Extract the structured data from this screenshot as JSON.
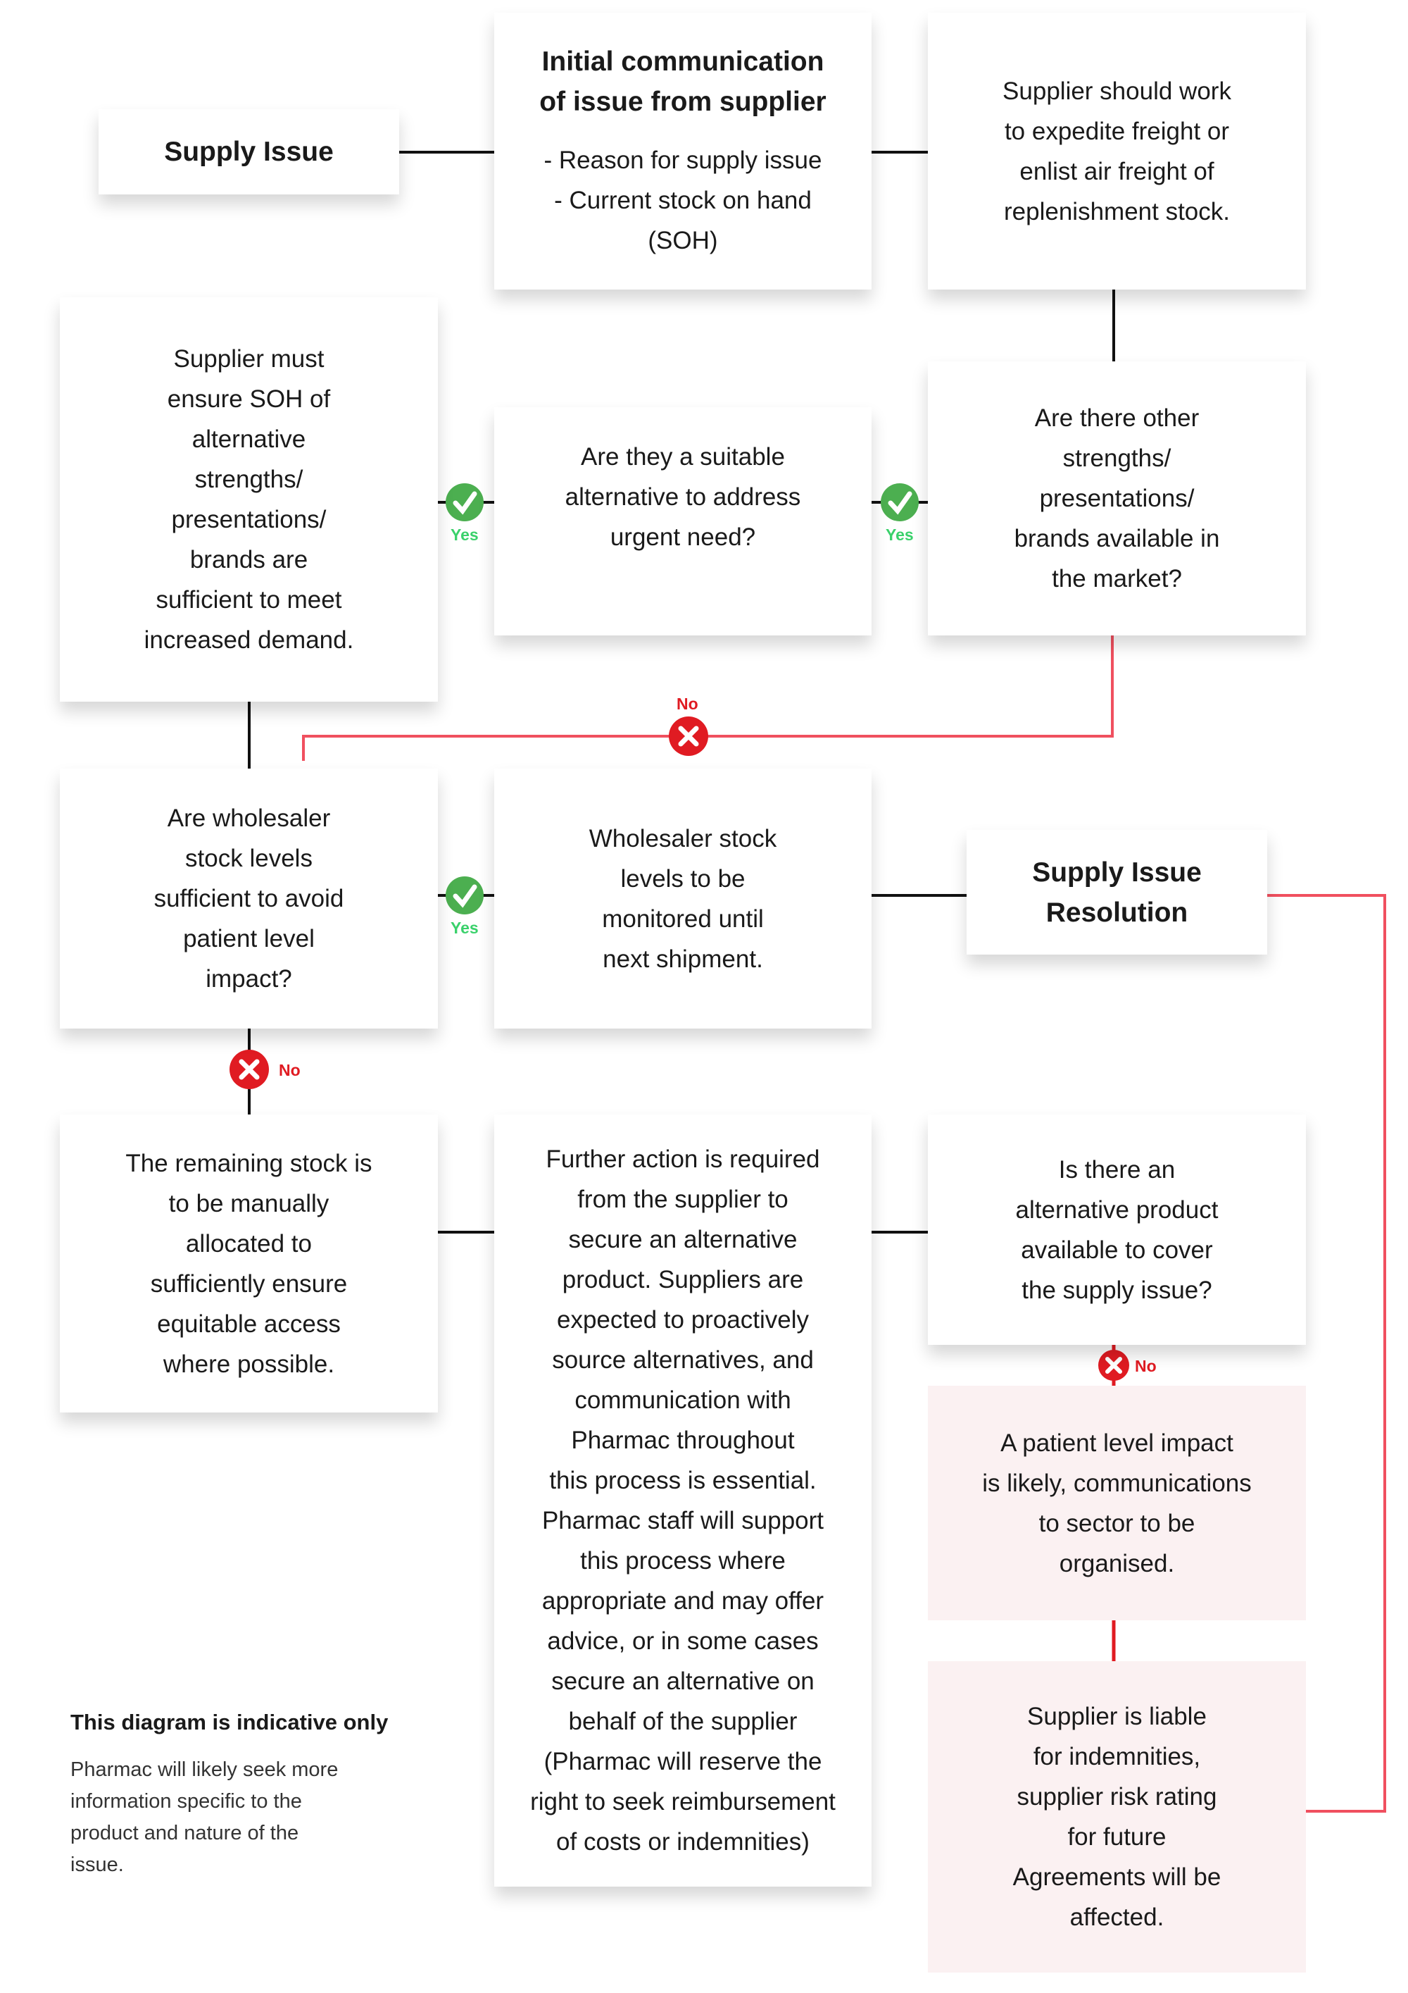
{
  "colors": {
    "yes": "#4caf50",
    "no": "#e01b22",
    "red_line": "#f0505f",
    "pink_box": "#fbf1f2"
  },
  "nodes": {
    "supply_issue": {
      "title": "Supply Issue"
    },
    "initial_comm": {
      "title": "Initial communication\nof issue from supplier",
      "body": "- Reason for supply issue\n- Current stock on hand\n(SOH)"
    },
    "expedite": {
      "body": "Supplier should work\nto expedite freight or\nenlist air freight of\nreplenishment stock."
    },
    "ensure_soh": {
      "body": "Supplier must\nensure SOH of\nalternative\nstrengths/\npresentations/\nbrands are\nsufficient to meet\nincreased demand."
    },
    "suitable": {
      "body": "Are they a suitable\nalternative to address\nurgent need?"
    },
    "other_strengths": {
      "body": "Are there other\nstrengths/\npresentations/\nbrands available in\nthe market?"
    },
    "wholesaler_levels": {
      "body": "Are wholesaler\nstock levels\nsufficient to avoid\npatient level\nimpact?"
    },
    "monitor": {
      "body": "Wholesaler stock\nlevels to be\nmonitored until\nnext shipment."
    },
    "resolution": {
      "title": "Supply Issue\nResolution"
    },
    "manual_alloc": {
      "body": "The remaining stock is\nto be manually\nallocated to\nsufficiently ensure\nequitable access\nwhere possible."
    },
    "further_action": {
      "body": "Further action is required\nfrom the supplier to\nsecure an alternative\nproduct. Suppliers are\nexpected to proactively\nsource alternatives, and\ncommunication with\nPharmac throughout\nthis process is essential.\nPharmac staff will support\nthis process where\nappropriate and may offer\nadvice, or in some cases\nsecure an alternative on\nbehalf of the supplier\n(Pharmac will reserve the\nright to seek reimbursement\nof costs or indemnities)"
    },
    "alt_product": {
      "body": "Is there an\nalternative product\navailable to cover\nthe supply issue?"
    },
    "patient_impact": {
      "body": "A patient level impact\nis likely, communications\nto sector to be\norganised."
    },
    "liable": {
      "body": "Supplier is liable\nfor indemnities,\nsupplier risk rating\nfor future\nAgreements will be\naffected."
    }
  },
  "labels": {
    "yes": "Yes",
    "no": "No"
  },
  "note": {
    "title": "This diagram is indicative only",
    "body": "Pharmac will likely seek more\ninformation specific to the\nproduct and nature of the\nissue."
  }
}
